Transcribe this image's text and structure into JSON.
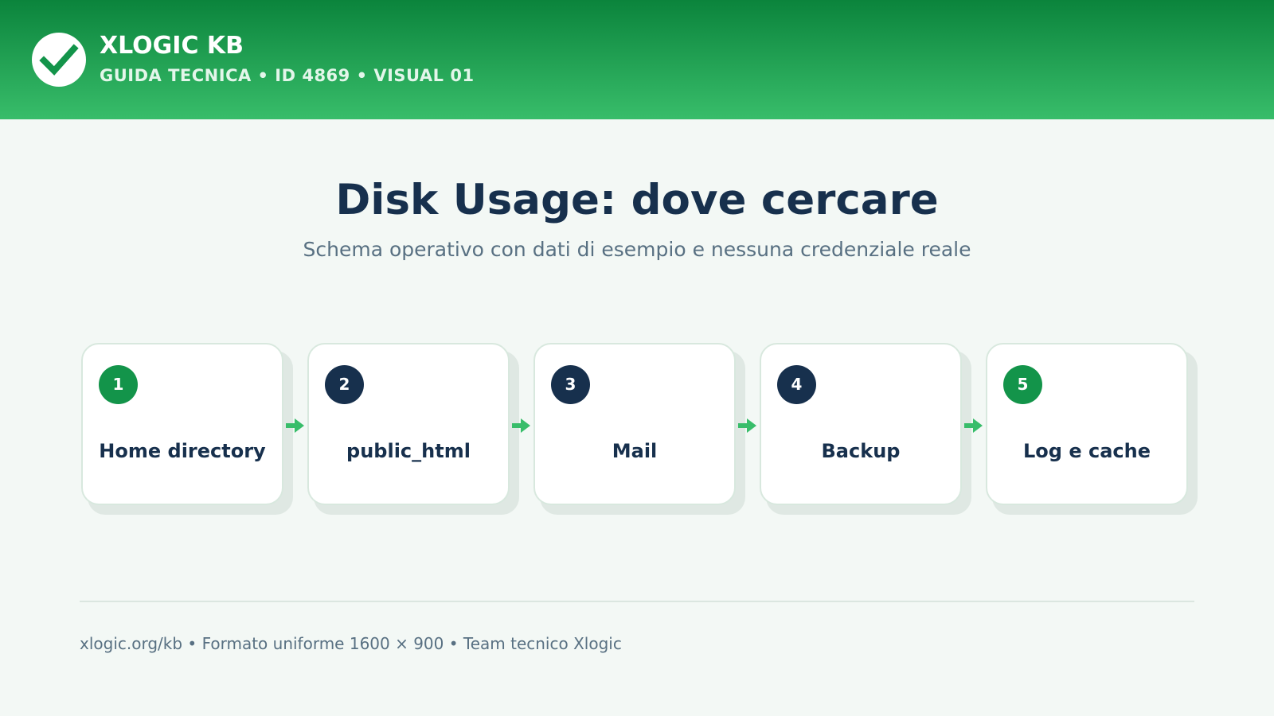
{
  "header": {
    "brand": "XLOGIC KB",
    "subtitle": "GUIDA TECNICA • ID 4869 • VISUAL 01",
    "logo_icon": "checkmark-icon"
  },
  "title": "Disk Usage: dove cercare",
  "subtitle": "Schema operativo con dati di esempio e nessuna credenziale reale",
  "steps": [
    {
      "number": "1",
      "label": "Home directory",
      "badge_color": "#13944a"
    },
    {
      "number": "2",
      "label": "public_html",
      "badge_color": "#17304d"
    },
    {
      "number": "3",
      "label": "Mail",
      "badge_color": "#17304d"
    },
    {
      "number": "4",
      "label": "Backup",
      "badge_color": "#17304d"
    },
    {
      "number": "5",
      "label": "Log e cache",
      "badge_color": "#13944a"
    }
  ],
  "connector_icon": "arrow-right-icon",
  "footer": "xlogic.org/kb • Formato uniforme 1600 × 900 • Team tecnico Xlogic",
  "colors": {
    "accent": "#13944a",
    "header_top": "#0b843c",
    "header_bottom": "#38bd6a",
    "navy": "#17304d",
    "arrow": "#38bd6a"
  }
}
